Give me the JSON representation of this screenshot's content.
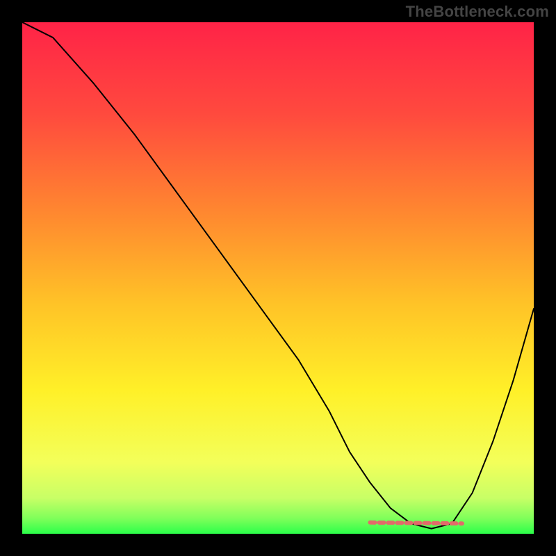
{
  "watermark": {
    "text": "TheBottleneck.com"
  },
  "chart_data": {
    "type": "line",
    "title": "",
    "xlabel": "",
    "ylabel": "",
    "xlim": [
      0,
      100
    ],
    "ylim": [
      0,
      100
    ],
    "series": [
      {
        "name": "curve",
        "stroke": "#000000",
        "stroke_width": 2,
        "x": [
          0,
          6,
          14,
          22,
          30,
          38,
          46,
          54,
          60,
          64,
          68,
          72,
          76,
          80,
          84,
          88,
          92,
          96,
          100
        ],
        "y": [
          100,
          97,
          88,
          78,
          67,
          56,
          45,
          34,
          24,
          16,
          10,
          5,
          2,
          1,
          2,
          8,
          18,
          30,
          44
        ]
      },
      {
        "name": "optimal-marker",
        "stroke": "#e26a6a",
        "stroke_width": 6,
        "dash": [
          7,
          6
        ],
        "x": [
          68,
          86
        ],
        "y": [
          2.2,
          2.0
        ]
      }
    ],
    "gradient_stops": [
      {
        "offset": 0,
        "color": "#ff2347"
      },
      {
        "offset": 0.18,
        "color": "#ff4a3e"
      },
      {
        "offset": 0.38,
        "color": "#ff8a2f"
      },
      {
        "offset": 0.55,
        "color": "#ffc327"
      },
      {
        "offset": 0.72,
        "color": "#fff028"
      },
      {
        "offset": 0.86,
        "color": "#f3ff5a"
      },
      {
        "offset": 0.93,
        "color": "#c8ff66"
      },
      {
        "offset": 0.97,
        "color": "#7fff5a"
      },
      {
        "offset": 1.0,
        "color": "#2bff4a"
      }
    ]
  }
}
